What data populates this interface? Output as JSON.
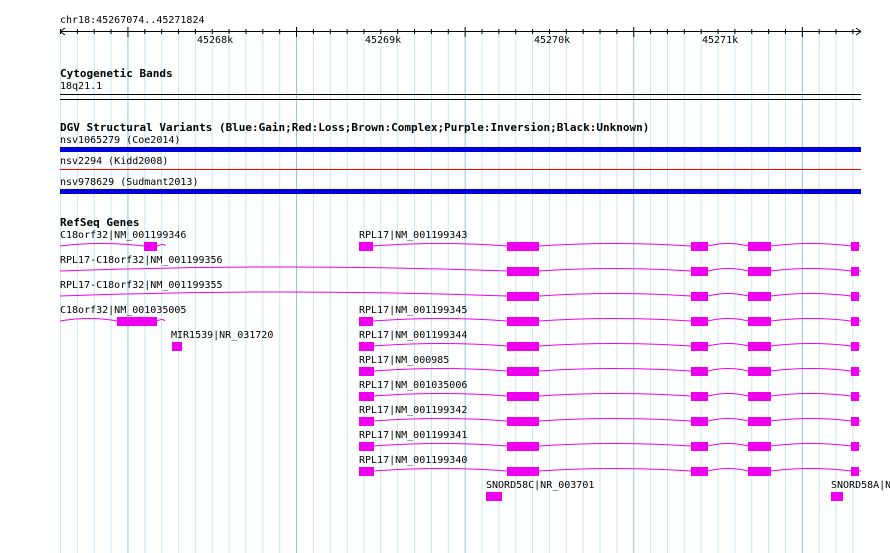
{
  "location": "chr18:45267074..45271824",
  "ruler": {
    "ticks": [
      "45268k",
      "45269k",
      "45270k",
      "45271k"
    ]
  },
  "tracks": {
    "cytoband": {
      "title": "Cytogenetic Bands",
      "band": "18q21.1"
    },
    "dgv": {
      "title": "DGV Structural Variants (Blue:Gain;Red:Loss;Brown:Complex;Purple:Inversion;Black:Unknown)",
      "variants": [
        {
          "label": "nsv1065279 (Coe2014)",
          "type": "gain",
          "color": "#0000dd"
        },
        {
          "label": "nsv2294 (Kidd2008)",
          "type": "loss",
          "color": "#ff0000"
        },
        {
          "label": "nsv978629 (Sudmant2013)",
          "type": "gain",
          "color": "#0000dd"
        }
      ]
    },
    "refseq": {
      "title": "RefSeq Genes",
      "color": "#ee00ee",
      "genes": [
        "C18orf32|NM_001199346",
        "RPL17|NM_001199343",
        "RPL17-C18orf32|NM_001199356",
        "RPL17-C18orf32|NM_001199355",
        "C18orf32|NM_001035005",
        "RPL17|NM_001199345",
        "MIR1539|NR_031720",
        "RPL17|NM_001199344",
        "RPL17|NM_000985",
        "RPL17|NM_001035006",
        "RPL17|NM_001199342",
        "RPL17|NM_001199341",
        "RPL17|NM_001199340",
        "SNORD58C|NR_003701",
        "SNORD58A|N"
      ]
    }
  }
}
